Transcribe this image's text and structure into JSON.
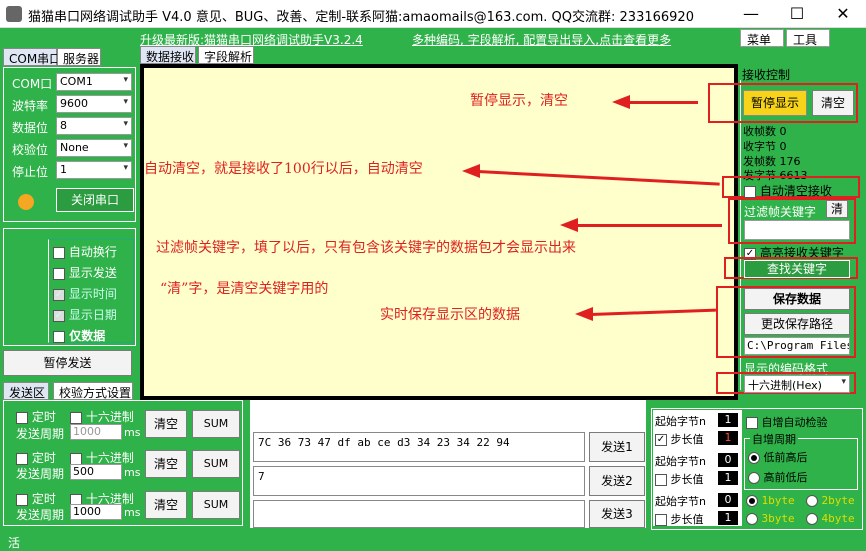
{
  "window": {
    "title": "猫猫串口网络调试助手 V4.0 意见、BUG、改善、定制-联系阿猫:amaomails@163.com. QQ交流群: 233166920",
    "minimize": "—",
    "maximize": "☐",
    "close": "✕"
  },
  "menubar": {
    "upgrade_link": "升级最新版:猫猫串口网络调试助手V3.2.4",
    "promo_link": "多种编码, 字段解析, 配置导出导入,点击查看更多",
    "menu": "菜单",
    "tools": "工具"
  },
  "left_tabs": {
    "com": "COM串口",
    "server": "服务器"
  },
  "serial": {
    "port_label": "COM口",
    "port_value": "COM1",
    "baud_label": "波特率",
    "baud_value": "9600",
    "data_label": "数据位",
    "data_value": "8",
    "parity_label": "校验位",
    "parity_value": "None",
    "stop_label": "停止位",
    "stop_value": "1",
    "close_button": "关闭串口",
    "status_color": "#f5a623"
  },
  "options": {
    "auto_wrap": "自动换行",
    "show_sent": "显示发送",
    "show_time": "显示时间",
    "show_date": "显示日期",
    "data_only": "仅数据"
  },
  "pause_send": "暂停发送",
  "bottom_tabs": {
    "send_area": "发送区",
    "checksum": "校验方式设置"
  },
  "display_tabs": {
    "receive": "数据接收",
    "parse": "字段解析"
  },
  "annotations": {
    "pause_clear": "暂停显示，清空",
    "auto_clear": "自动清空，就是接收了100行以后，自动清空",
    "filter": "过滤帧关键字，填了以后，只有包含该关键字的数据包才会显示出来",
    "clear_word": "“清”字，是清空关键字用的",
    "save": "实时保存显示区的数据"
  },
  "receive_control": {
    "header": "接收控制",
    "pause_display": "暂停显示",
    "clear": "清空",
    "rx_frames": "收帧数 0",
    "rx_bytes": "收字节 0",
    "tx_frames": "发帧数 176",
    "tx_bytes": "发字节 6613",
    "auto_clear": "自动清空接收",
    "filter_label": "过滤帧关键字",
    "filter_clear": "清",
    "highlight": "高亮接收关键字",
    "find_keyword": "查找关键字",
    "save_data": "保存数据",
    "change_path": "更改保存路径",
    "path_value": "C:\\Program Files",
    "encoding_label": "显示的编码格式",
    "encoding_value": "十六进制(Hex)"
  },
  "send_rows": [
    {
      "timed": "定时",
      "hex": "十六进制",
      "period": "发送周期",
      "period_value": "1000",
      "unit": "ms",
      "clear": "清空",
      "sum": "SUM",
      "content": "7C 36 73 47 df ab ce d3 34 23 34 22 94",
      "send": "发送1"
    },
    {
      "timed": "定时",
      "hex": "十六进制",
      "period": "发送周期",
      "period_value": "500",
      "unit": "ms",
      "clear": "清空",
      "sum": "SUM",
      "content": "7",
      "send": "发送2"
    },
    {
      "timed": "定时",
      "hex": "十六进制",
      "period": "发送周期",
      "period_value": "1000",
      "unit": "ms",
      "clear": "清空",
      "sum": "SUM",
      "content": "",
      "send": "发送3"
    }
  ],
  "checksum_panel": {
    "start_byte": "起始字节n",
    "step": "步长值",
    "auto_check": "自增自动检验",
    "period_group": "自增周期",
    "low_high": "低前高后",
    "high_low": "高前低后",
    "byte1": "1byte",
    "byte2": "2byte",
    "byte3": "3byte",
    "byte4": "4byte",
    "v1": "1",
    "v2": "1",
    "v3": "0",
    "v4": "1",
    "v5": "0",
    "v6": "1"
  },
  "status": "活"
}
